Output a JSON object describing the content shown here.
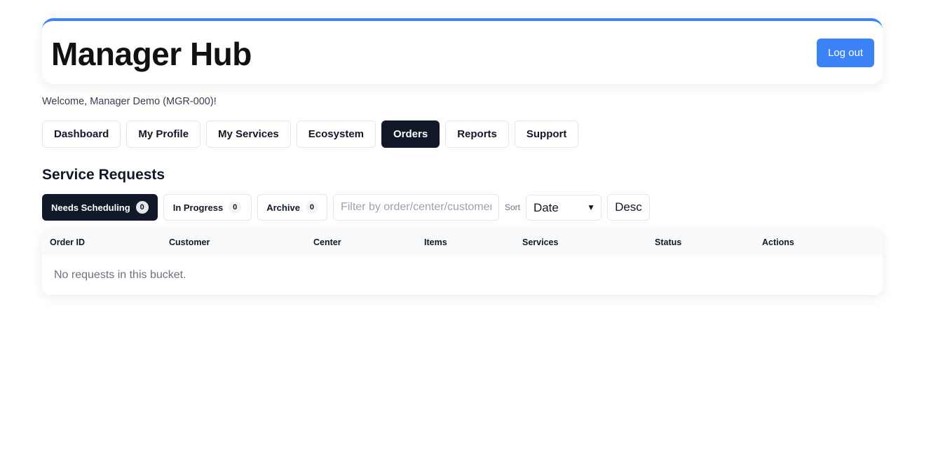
{
  "header": {
    "title": "Manager Hub",
    "logout_label": "Log out",
    "accent_color": "#3b82f6"
  },
  "welcome": "Welcome, Manager Demo (MGR-000)!",
  "nav": {
    "tabs": [
      {
        "label": "Dashboard",
        "active": false
      },
      {
        "label": "My Profile",
        "active": false
      },
      {
        "label": "My Services",
        "active": false
      },
      {
        "label": "Ecosystem",
        "active": false
      },
      {
        "label": "Orders",
        "active": true
      },
      {
        "label": "Reports",
        "active": false
      },
      {
        "label": "Support",
        "active": false
      }
    ]
  },
  "section_title": "Service Requests",
  "buckets": [
    {
      "label": "Needs Scheduling",
      "count": "0",
      "active": true
    },
    {
      "label": "In Progress",
      "count": "0",
      "active": false
    },
    {
      "label": "Archive",
      "count": "0",
      "active": false
    }
  ],
  "filter": {
    "placeholder": "Filter by order/center/customer",
    "value": ""
  },
  "sort": {
    "label": "Sort",
    "selected": "Date",
    "direction_label": "Desc"
  },
  "table": {
    "columns": [
      "Order ID",
      "Customer",
      "Center",
      "Items",
      "Services",
      "Status",
      "Actions"
    ],
    "empty_message": "No requests in this bucket."
  }
}
